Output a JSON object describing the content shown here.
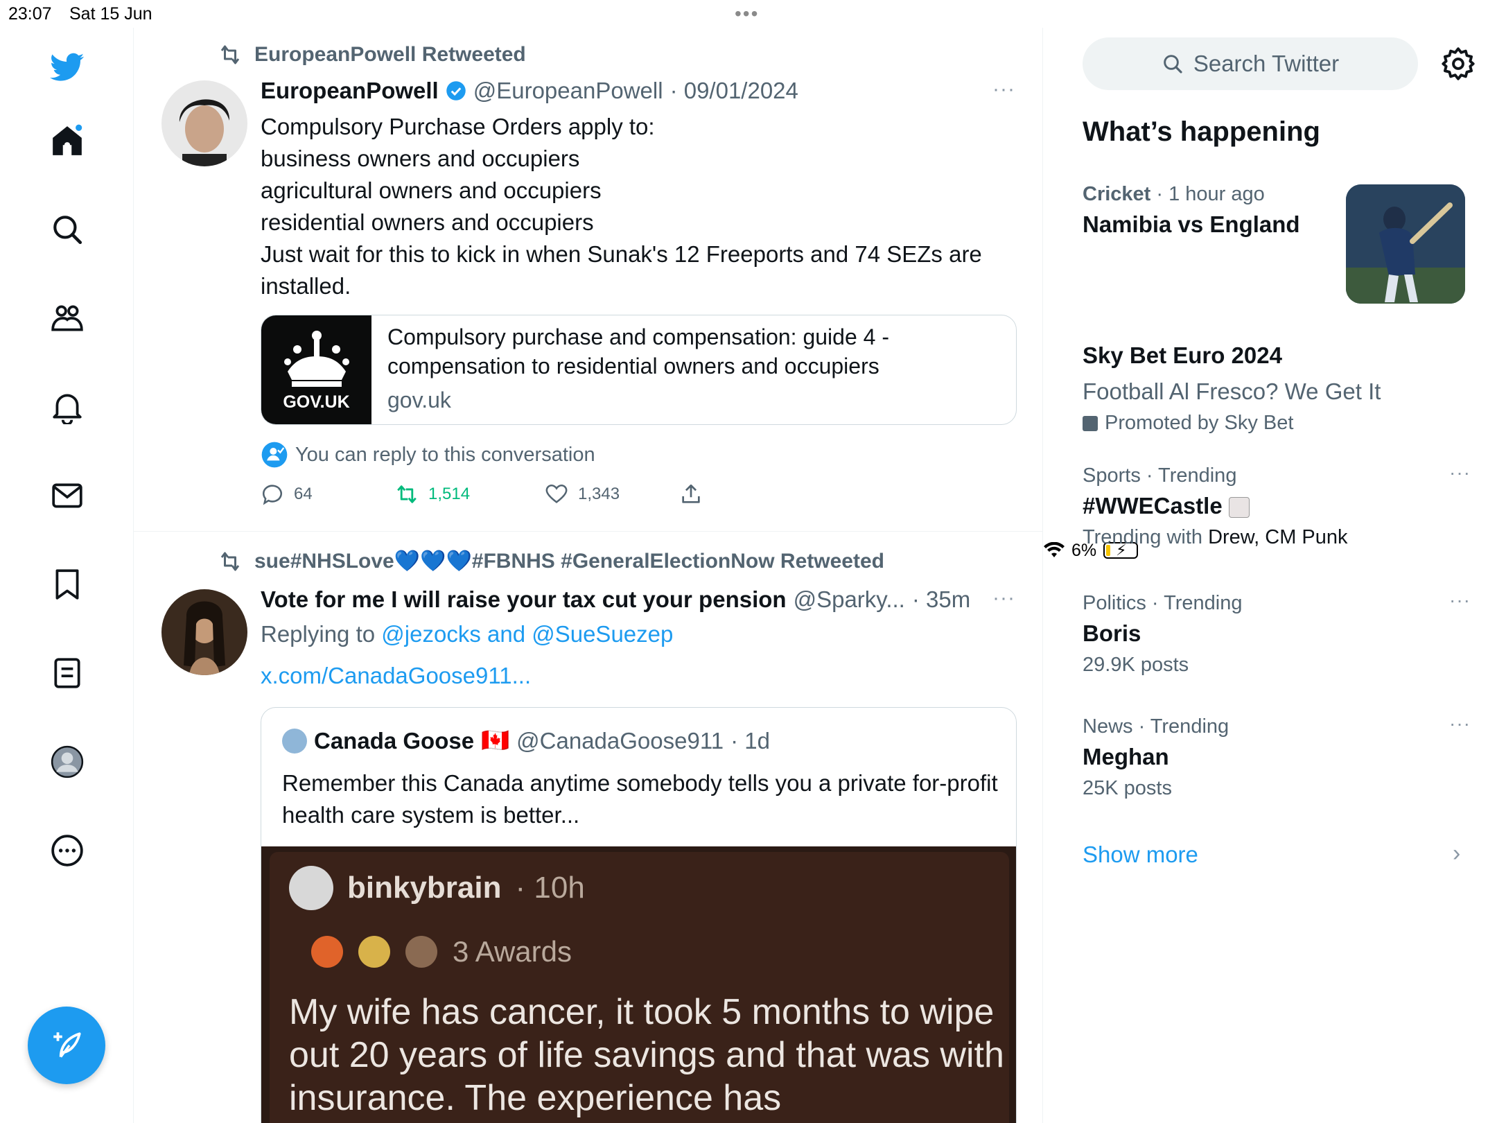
{
  "status_bar": {
    "time": "23:07",
    "date": "Sat 15 Jun",
    "battery": "6%"
  },
  "nav": {
    "items": [
      "home-icon",
      "search-icon",
      "communities-icon",
      "notifications-icon",
      "messages-icon",
      "bookmarks-icon",
      "lists-icon",
      "profile-icon",
      "more-icon"
    ],
    "compose_icon": "compose-icon"
  },
  "tweet1": {
    "retweeted_by": "EuropeanPowell Retweeted",
    "name": "EuropeanPowell",
    "handle": "@EuropeanPowell",
    "time": "· 09/01/2024",
    "more": "···",
    "lines": [
      "Compulsory Purchase Orders apply to:",
      "business owners and occupiers",
      "agricultural owners and occupiers",
      "residential owners and occupiers",
      "Just wait for this to kick in when Sunak's 12 Freeports and 74 SEZs are installed."
    ],
    "card": {
      "thumb_label": "GOV.UK",
      "title": "Compulsory purchase and compensation: guide 4 - compensation to residential owners and occupiers",
      "domain": "gov.uk"
    },
    "reply_note": "You can reply to this conversation",
    "replies": "64",
    "retweets": "1,514",
    "likes": "1,343"
  },
  "tweet2": {
    "retweeted_by": "sue#NHSLove💙💙💙#FBNHS #GeneralElectionNow Retweeted",
    "name": "Vote for me I will raise your tax cut your pension",
    "handle": "@Sparky...",
    "time": "· 35m",
    "more": "···",
    "replying_label": "Replying to",
    "replying_mentions": "@jezocks and @SueSuezep",
    "link": "x.com/CanadaGoose911...",
    "quote": {
      "name": "Canada Goose",
      "flag": "🇨🇦",
      "handle": "@CanadaGoose911",
      "time": "· 1d",
      "text": "Remember this Canada anytime somebody tells you a private for-profit health care system is better...",
      "media": {
        "user": "binkybrain",
        "time": "· 10h",
        "awards": "3 Awards",
        "text": "My wife has cancer, it took 5 months to wipe out 20 years of life savings and that was with insurance. The experience has"
      }
    }
  },
  "sidebar": {
    "search_placeholder": "Search Twitter",
    "heading": "What’s happening",
    "trends": [
      {
        "category": "Cricket",
        "meta_rest": "· 1 hour ago",
        "title": "Namibia vs England"
      },
      {
        "title": "Sky Bet Euro 2024",
        "subtitle": "Football Al Fresco? We Get It",
        "promoted": "Promoted by Sky Bet"
      },
      {
        "category": "Sports · Trending",
        "title": "#WWECastle",
        "sub_prefix": "Trending with",
        "sub_names": "Drew, CM Punk"
      },
      {
        "category": "Politics · Trending",
        "title": "Boris",
        "sub": "29.9K posts"
      },
      {
        "category": "News · Trending",
        "title": "Meghan",
        "sub": "25K posts"
      }
    ],
    "show_more": "Show more"
  },
  "colors": {
    "accent": "#1d9bf0",
    "retweet_green": "#00ba7c",
    "muted": "#536471"
  }
}
